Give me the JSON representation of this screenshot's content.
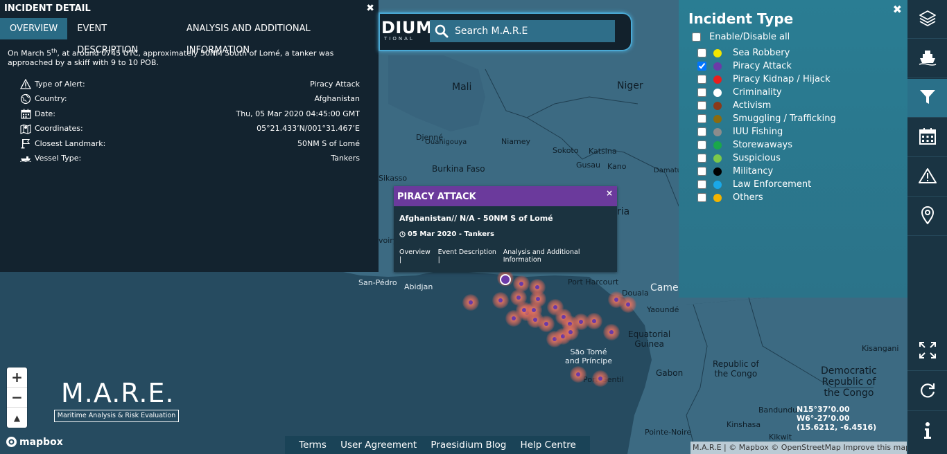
{
  "detail": {
    "title": "INCIDENT DETAIL",
    "close": "✖",
    "tabs": [
      "OVERVIEW",
      "EVENT DESCRIPTION",
      "ANALYSIS AND ADDITIONAL INFORMATION"
    ],
    "desc_part1": "On March 5",
    "desc_sup": "th",
    "desc_part2": ", at around 0745 UTC, approximately 50NM South of Lomé, a tanker was approached by a skiff with 9 to 10 POB.",
    "rows": [
      {
        "label": "Type of Alert:",
        "value": "Piracy Attack",
        "icon": "warning-icon"
      },
      {
        "label": "Country:",
        "value": "Afghanistan",
        "icon": "globe-icon"
      },
      {
        "label": "Date:",
        "value": "Thu, 05 Mar 2020 04:45:00 GMT",
        "icon": "calendar-icon"
      },
      {
        "label": "Coordinates:",
        "value": "05°21.433’N/001°31.467’E",
        "icon": "map-icon"
      },
      {
        "label": "Closest Landmark:",
        "value": "50NM S of Lomé",
        "icon": "flag-icon"
      },
      {
        "label": "Vessel Type:",
        "value": "Tankers",
        "icon": "ship-icon"
      }
    ]
  },
  "search": {
    "logo_fragment": "DIUM",
    "logo_sub": "TIONAL",
    "placeholder": "Search M.A.R.E"
  },
  "incident_types": {
    "title": "Incident Type",
    "close": "✖",
    "enable_all": "Enable/Disable all",
    "items": [
      {
        "label": "Sea Robbery",
        "color": "#f2e600",
        "checked": false
      },
      {
        "label": "Piracy Attack",
        "color": "#6b3aa8",
        "checked": true
      },
      {
        "label": "Piracy Kidnap / Hijack",
        "color": "#e81e1e",
        "checked": false
      },
      {
        "label": "Criminality",
        "color": "#ffffff",
        "checked": false
      },
      {
        "label": "Activism",
        "color": "#8b3a1a",
        "checked": false
      },
      {
        "label": "Smuggling / Trafficking",
        "color": "#8a6b10",
        "checked": false
      },
      {
        "label": "IUU Fishing",
        "color": "#8c8c8c",
        "checked": false
      },
      {
        "label": "Storewaways",
        "color": "#1aa84a",
        "checked": false
      },
      {
        "label": "Suspicious",
        "color": "#7cc84a",
        "checked": false
      },
      {
        "label": "Militancy",
        "color": "#000000",
        "checked": false
      },
      {
        "label": "Law Enforcement",
        "color": "#1aa8e8",
        "checked": false
      },
      {
        "label": "Others",
        "color": "#f2b400",
        "checked": false
      }
    ]
  },
  "popup": {
    "title": "PIRACY ATTACK",
    "close": "×",
    "location": "Afghanistan// N/A - 50NM S of Lomé",
    "date": "05 Mar 2020 - Tankers",
    "links": [
      "Overview |",
      "Event Description |",
      "Analysis and Additional Information"
    ]
  },
  "map_labels": {
    "mali": "Mali",
    "niger": "Niger",
    "djenne": "Djenné",
    "ouahigouya": "Ouahigouya",
    "niamey": "Niamey",
    "sokoto": "Sokoto",
    "katsina": "Katsina",
    "gusau": "Gusau",
    "kano": "Kano",
    "damatu": "Damatu",
    "burkina": "Burkina Faso",
    "sikasso": "Sikasso",
    "voiry": "voiry",
    "ria": "ria",
    "san_pedro": "San-Pédro",
    "abidjan": "Abidjan",
    "port_harcourt": "Port Harcourt",
    "douala": "Douala",
    "camer": "Camer",
    "yaounde": "Yaoundé",
    "eq_guinea": "Equatorial\nGuinea",
    "sao_tome": "São Tomé\nand Príncipe",
    "gabon": "Gabon",
    "port_gentil": "Port-Gentil",
    "rep_congo": "Republic of\nthe Congo",
    "drc": "Democratic\nRepublic of\nthe Congo",
    "kisangani": "Kisangani",
    "bandundu": "Bandundu",
    "kinshasa": "Kinshasa",
    "pointe_noire": "Pointe-Noire",
    "kikwit": "Kikwit"
  },
  "zoom": {
    "in": "+",
    "out": "−",
    "compass": "▲"
  },
  "mare_logo": {
    "title": "M.A.R.E.",
    "subtitle": "Maritime Analysis & Risk Evaluation"
  },
  "mapbox": "mapbox",
  "footer": [
    "Terms",
    "User Agreement",
    "Praesidium Blog",
    "Help Centre"
  ],
  "coords": {
    "lat": "N15°37’0.00",
    "lon": "W6°-27’0.00",
    "decimal": "(15.6212, -6.4516)"
  },
  "attribution": "M.A.R.E | © Mapbox © OpenStreetMap Improve this map"
}
